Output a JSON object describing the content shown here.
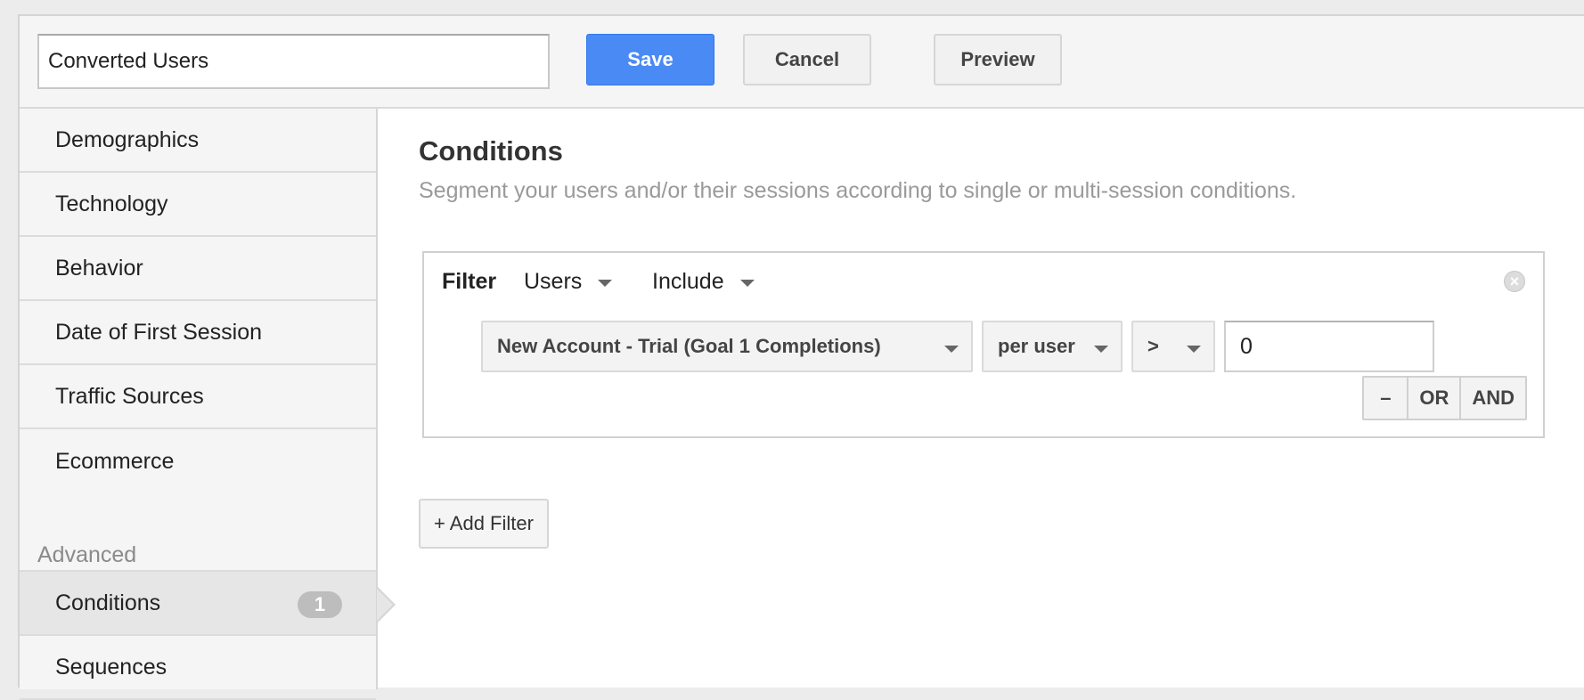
{
  "header": {
    "segment_name": "Converted Users",
    "save_label": "Save",
    "cancel_label": "Cancel",
    "preview_label": "Preview"
  },
  "sidebar": {
    "items": [
      {
        "label": "Demographics"
      },
      {
        "label": "Technology"
      },
      {
        "label": "Behavior"
      },
      {
        "label": "Date of First Session"
      },
      {
        "label": "Traffic Sources"
      },
      {
        "label": "Ecommerce"
      }
    ],
    "advanced_heading": "Advanced",
    "advanced_items": [
      {
        "label": "Conditions",
        "badge": "1",
        "active": true
      },
      {
        "label": "Sequences"
      }
    ]
  },
  "main": {
    "title": "Conditions",
    "description": "Segment your users and/or their sessions according to single or multi-session conditions.",
    "filter": {
      "label": "Filter",
      "scope": "Users",
      "mode": "Include",
      "condition": {
        "metric": "New Account - Trial (Goal 1 Completions)",
        "per": "per user",
        "operator": ">",
        "value": "0"
      },
      "logic": {
        "minus": "–",
        "or": "OR",
        "and": "AND"
      }
    },
    "add_filter_label": "+ Add Filter"
  },
  "colors": {
    "save_button": "#4a8af4",
    "sidebar_bg": "#f5f5f5",
    "active_item_bg": "#e6e6e6",
    "badge_bg": "#bdbdbd"
  }
}
